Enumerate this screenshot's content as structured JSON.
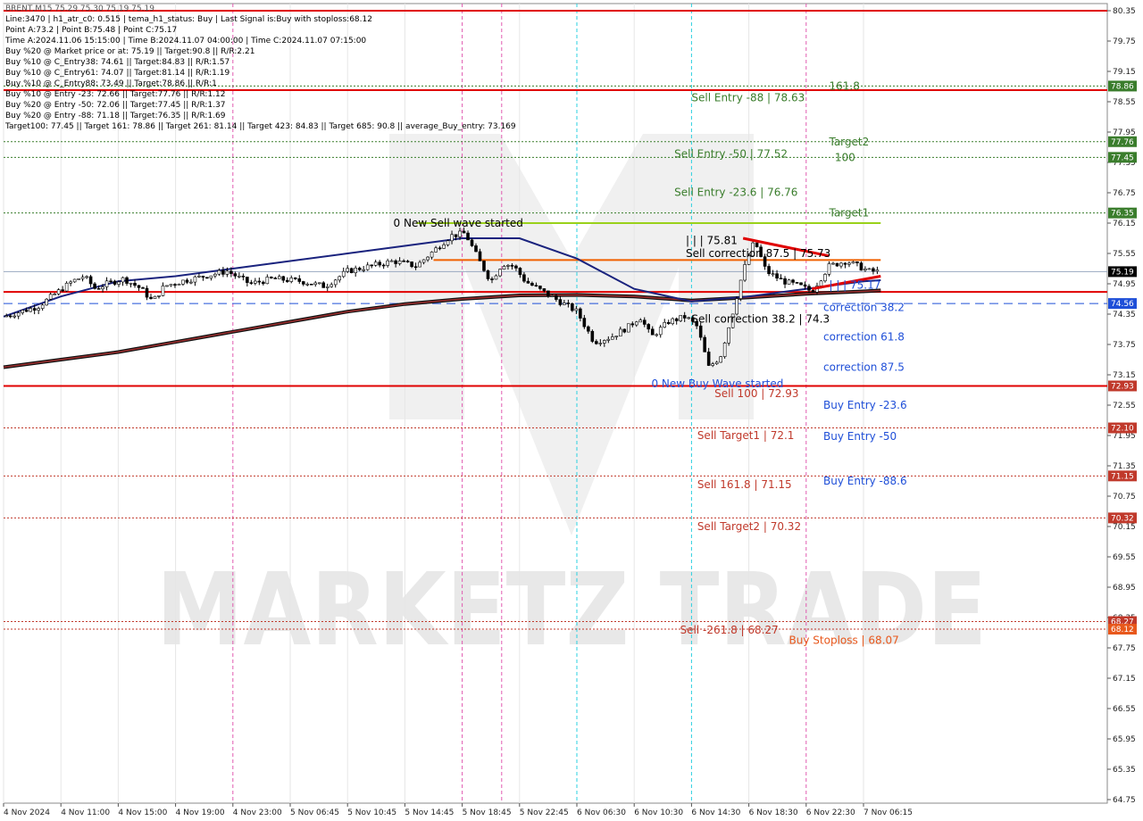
{
  "chart_data": {
    "type": "candlestick",
    "symbol_line": "BRENT,M15  75.29 75.30 75.19 75.19",
    "info_lines": [
      "Line:3470  |  h1_atr_c0: 0.515  |  tema_h1_status: Buy  |  Last Signal is:Buy with stoploss:68.12",
      "Point A:73.2  |  Point B:75.48  |  Point C:75.17",
      "Time A:2024.11.06 15:15:00  |  Time B:2024.11.07 04:00:00  |  Time C:2024.11.07 07:15:00",
      "Buy %20 @ Market price or at: 75.19  ||  Target:90.8  ||  R/R:2.21",
      "Buy %10 @ C_Entry38: 74.61  ||  Target:84.83  ||  R/R:1.57",
      "Buy %10 @ C_Entry61: 74.07  ||  Target:81.14  ||  R/R:1.19",
      "Buy %10 @ C_Entry88: 73.49  ||  Target:78.86  ||  R/R:1",
      "Buy %10 @ Entry -23: 72.66  ||  Target:77.76  ||  R/R:1.12",
      "Buy %20 @ Entry -50: 72.06  ||  Target:77.45  ||  R/R:1.37",
      "Buy %20 @ Entry -88: 71.18  ||  Target:76.35  ||  R/R:1.69",
      "Target100: 77.45  ||  Target 161: 78.86  ||  Target 261: 81.14  ||  Target 423: 84.83  ||  Target 685: 90.8  ||  average_Buy_entry: 73.169"
    ],
    "y_ticks": [
      "80.35",
      "79.75",
      "79.15",
      "78.55",
      "77.95",
      "77.35",
      "76.75",
      "76.15",
      "75.55",
      "74.95",
      "74.35",
      "73.75",
      "73.15",
      "72.55",
      "71.95",
      "71.35",
      "70.75",
      "70.15",
      "69.55",
      "68.95",
      "68.35",
      "67.75",
      "67.15",
      "66.55",
      "65.95",
      "65.35",
      "64.75"
    ],
    "ylim": [
      64.75,
      80.35
    ],
    "x_labels": [
      "4 Nov 2024",
      "4 Nov 11:00",
      "4 Nov 15:00",
      "4 Nov 19:00",
      "4 Nov 23:00",
      "5 Nov 06:45",
      "5 Nov 10:45",
      "5 Nov 14:45",
      "5 Nov 18:45",
      "5 Nov 22:45",
      "6 Nov 06:30",
      "6 Nov 10:30",
      "6 Nov 14:30",
      "6 Nov 18:30",
      "6 Nov 22:30",
      "7 Nov 06:15"
    ],
    "current_price": {
      "label": "75.19",
      "value": 75.19,
      "color": "#000000"
    },
    "price_tags": [
      {
        "label": "78.86",
        "value": 78.86,
        "color": "#3a7d2c"
      },
      {
        "label": "77.76",
        "value": 77.76,
        "color": "#3a7d2c"
      },
      {
        "label": "77.45",
        "value": 77.45,
        "color": "#3a7d2c"
      },
      {
        "label": "76.35",
        "value": 76.35,
        "color": "#3a7d2c"
      },
      {
        "label": "74.56",
        "value": 74.56,
        "color": "#1f4fd8"
      },
      {
        "label": "72.93",
        "value": 72.93,
        "color": "#c0392b"
      },
      {
        "label": "72.10",
        "value": 72.1,
        "color": "#c0392b"
      },
      {
        "label": "71.15",
        "value": 71.15,
        "color": "#c0392b"
      },
      {
        "label": "70.32",
        "value": 70.32,
        "color": "#c0392b"
      },
      {
        "label": "68.27",
        "value": 68.27,
        "color": "#c0392b"
      },
      {
        "label": "68.12",
        "value": 68.12,
        "color": "#e8581c"
      }
    ],
    "levels": [
      {
        "value": 80.35,
        "style": "solid-red"
      },
      {
        "value": 78.78,
        "style": "solid-red"
      },
      {
        "value": 78.86,
        "style": "dotted-green"
      },
      {
        "value": 77.76,
        "style": "dotted-green"
      },
      {
        "value": 77.45,
        "style": "dotted-green"
      },
      {
        "value": 76.35,
        "style": "dotted-green"
      },
      {
        "value": 74.56,
        "style": "dashed-blue"
      },
      {
        "value": 74.79,
        "style": "solid-red"
      },
      {
        "value": 72.93,
        "style": "solid-red"
      },
      {
        "value": 72.1,
        "style": "dotted-red"
      },
      {
        "value": 71.15,
        "style": "dotted-red"
      },
      {
        "value": 70.32,
        "style": "dotted-red"
      },
      {
        "value": 68.27,
        "style": "dotted-red"
      },
      {
        "value": 68.12,
        "style": "dotted-red"
      }
    ],
    "annotations": [
      {
        "text": "161.8",
        "x_idx": 14.4,
        "price": 78.86,
        "color": "#3a7d2c"
      },
      {
        "text": "Sell Entry -88 | 78.63",
        "x_idx": 12.0,
        "price": 78.63,
        "color": "#3a7d2c"
      },
      {
        "text": "Target2",
        "x_idx": 14.4,
        "price": 77.76,
        "color": "#3a7d2c"
      },
      {
        "text": "Sell Entry -50 | 77.52",
        "x_idx": 11.7,
        "price": 77.52,
        "color": "#3a7d2c"
      },
      {
        "text": "100",
        "x_idx": 14.5,
        "price": 77.45,
        "color": "#3a7d2c"
      },
      {
        "text": "Sell Entry -23.6 | 76.76",
        "x_idx": 11.7,
        "price": 76.76,
        "color": "#3a7d2c"
      },
      {
        "text": "Target1",
        "x_idx": 14.4,
        "price": 76.35,
        "color": "#3a7d2c"
      },
      {
        "text": "0 New Sell wave started",
        "x_idx": 6.8,
        "price": 76.15,
        "color": "#000000"
      },
      {
        "text": "| | | 75.81",
        "x_idx": 11.9,
        "price": 75.81,
        "color": "#000000"
      },
      {
        "text": "Sell correction 87.5 | 75.73",
        "x_idx": 11.9,
        "price": 75.55,
        "color": "#000000"
      },
      {
        "text": "| | | 75.17",
        "x_idx": 14.4,
        "price": 74.92,
        "color": "#1f4fd8"
      },
      {
        "text": "correction 38.2",
        "x_idx": 14.3,
        "price": 74.48,
        "color": "#1f4fd8"
      },
      {
        "text": "Sell correction 38.2 | 74.3",
        "x_idx": 12.0,
        "price": 74.25,
        "color": "#000000"
      },
      {
        "text": "correction 61.8",
        "x_idx": 14.3,
        "price": 73.9,
        "color": "#1f4fd8"
      },
      {
        "text": "correction 87.5",
        "x_idx": 14.3,
        "price": 73.3,
        "color": "#1f4fd8"
      },
      {
        "text": "0 New Buy Wave started",
        "x_idx": 11.3,
        "price": 72.97,
        "color": "#1f4fd8"
      },
      {
        "text": "Sell 100 | 72.93",
        "x_idx": 12.4,
        "price": 72.78,
        "color": "#c0392b"
      },
      {
        "text": "Buy Entry -23.6",
        "x_idx": 14.3,
        "price": 72.55,
        "color": "#1f4fd8"
      },
      {
        "text": "Sell Target1 | 72.1",
        "x_idx": 12.1,
        "price": 71.95,
        "color": "#c0392b"
      },
      {
        "text": "Buy Entry -50",
        "x_idx": 14.3,
        "price": 71.93,
        "color": "#1f4fd8"
      },
      {
        "text": "Buy Entry -88.6",
        "x_idx": 14.3,
        "price": 71.05,
        "color": "#1f4fd8"
      },
      {
        "text": "Sell 161.8 | 71.15",
        "x_idx": 12.1,
        "price": 70.98,
        "color": "#c0392b"
      },
      {
        "text": "Sell Target2 | 70.32",
        "x_idx": 12.1,
        "price": 70.15,
        "color": "#c0392b"
      },
      {
        "text": "Sell -261.8 | 68.27",
        "x_idx": 11.8,
        "price": 68.1,
        "color": "#c0392b"
      },
      {
        "text": "Buy Stoploss | 68.07",
        "x_idx": 13.7,
        "price": 67.9,
        "color": "#e8581c"
      }
    ],
    "watermark": "MARKETZ TRADE",
    "price_path": [
      [
        0,
        74.3
      ],
      [
        0.3,
        74.4
      ],
      [
        0.6,
        74.5
      ],
      [
        0.9,
        74.75
      ],
      [
        1.2,
        75.0
      ],
      [
        1.4,
        75.1
      ],
      [
        1.6,
        74.85
      ],
      [
        1.8,
        74.95
      ],
      [
        2.1,
        75.05
      ],
      [
        2.4,
        74.85
      ],
      [
        2.6,
        74.6
      ],
      [
        2.8,
        74.9
      ],
      [
        3.1,
        75.0
      ],
      [
        3.5,
        75.1
      ],
      [
        3.9,
        75.2
      ],
      [
        4.3,
        74.95
      ],
      [
        4.7,
        75.05
      ],
      [
        5.2,
        75.0
      ],
      [
        5.6,
        74.9
      ],
      [
        6.0,
        75.2
      ],
      [
        6.4,
        75.3
      ],
      [
        6.8,
        75.4
      ],
      [
        7.2,
        75.3
      ],
      [
        7.5,
        75.6
      ],
      [
        7.8,
        75.9
      ],
      [
        8.05,
        75.95
      ],
      [
        8.3,
        75.4
      ],
      [
        8.5,
        75.0
      ],
      [
        8.7,
        75.35
      ],
      [
        8.9,
        75.3
      ],
      [
        9.1,
        75.0
      ],
      [
        9.4,
        74.8
      ],
      [
        9.7,
        74.6
      ],
      [
        10.0,
        74.4
      ],
      [
        10.3,
        73.8
      ],
      [
        10.6,
        73.9
      ],
      [
        10.9,
        74.1
      ],
      [
        11.1,
        74.3
      ],
      [
        11.3,
        73.9
      ],
      [
        11.6,
        74.2
      ],
      [
        11.9,
        74.3
      ],
      [
        12.1,
        74.1
      ],
      [
        12.3,
        73.3
      ],
      [
        12.5,
        73.5
      ],
      [
        12.7,
        74.3
      ],
      [
        12.9,
        75.2
      ],
      [
        13.1,
        75.8
      ],
      [
        13.3,
        75.2
      ],
      [
        13.6,
        75.0
      ],
      [
        13.9,
        74.9
      ],
      [
        14.1,
        74.8
      ],
      [
        14.4,
        75.3
      ],
      [
        14.7,
        75.4
      ],
      [
        14.9,
        75.3
      ],
      [
        15.1,
        75.2
      ],
      [
        15.3,
        75.19
      ]
    ],
    "ma_fast": [
      [
        0,
        74.3
      ],
      [
        1,
        74.7
      ],
      [
        2,
        75.0
      ],
      [
        3,
        75.1
      ],
      [
        4,
        75.25
      ],
      [
        5,
        75.4
      ],
      [
        6,
        75.55
      ],
      [
        7,
        75.7
      ],
      [
        8,
        75.85
      ],
      [
        9,
        75.85
      ],
      [
        10,
        75.45
      ],
      [
        11,
        74.85
      ],
      [
        12,
        74.6
      ],
      [
        13,
        74.7
      ],
      [
        14,
        74.85
      ],
      [
        15,
        75.0
      ],
      [
        15.3,
        75.02
      ]
    ],
    "ma_slow": [
      [
        0,
        73.3
      ],
      [
        1,
        73.45
      ],
      [
        2,
        73.6
      ],
      [
        3,
        73.8
      ],
      [
        4,
        74.0
      ],
      [
        5,
        74.2
      ],
      [
        6,
        74.4
      ],
      [
        7,
        74.55
      ],
      [
        8,
        74.65
      ],
      [
        9,
        74.72
      ],
      [
        10,
        74.73
      ],
      [
        11,
        74.7
      ],
      [
        12,
        74.62
      ],
      [
        13,
        74.68
      ],
      [
        14,
        74.75
      ],
      [
        15,
        74.8
      ],
      [
        15.3,
        74.82
      ]
    ]
  }
}
